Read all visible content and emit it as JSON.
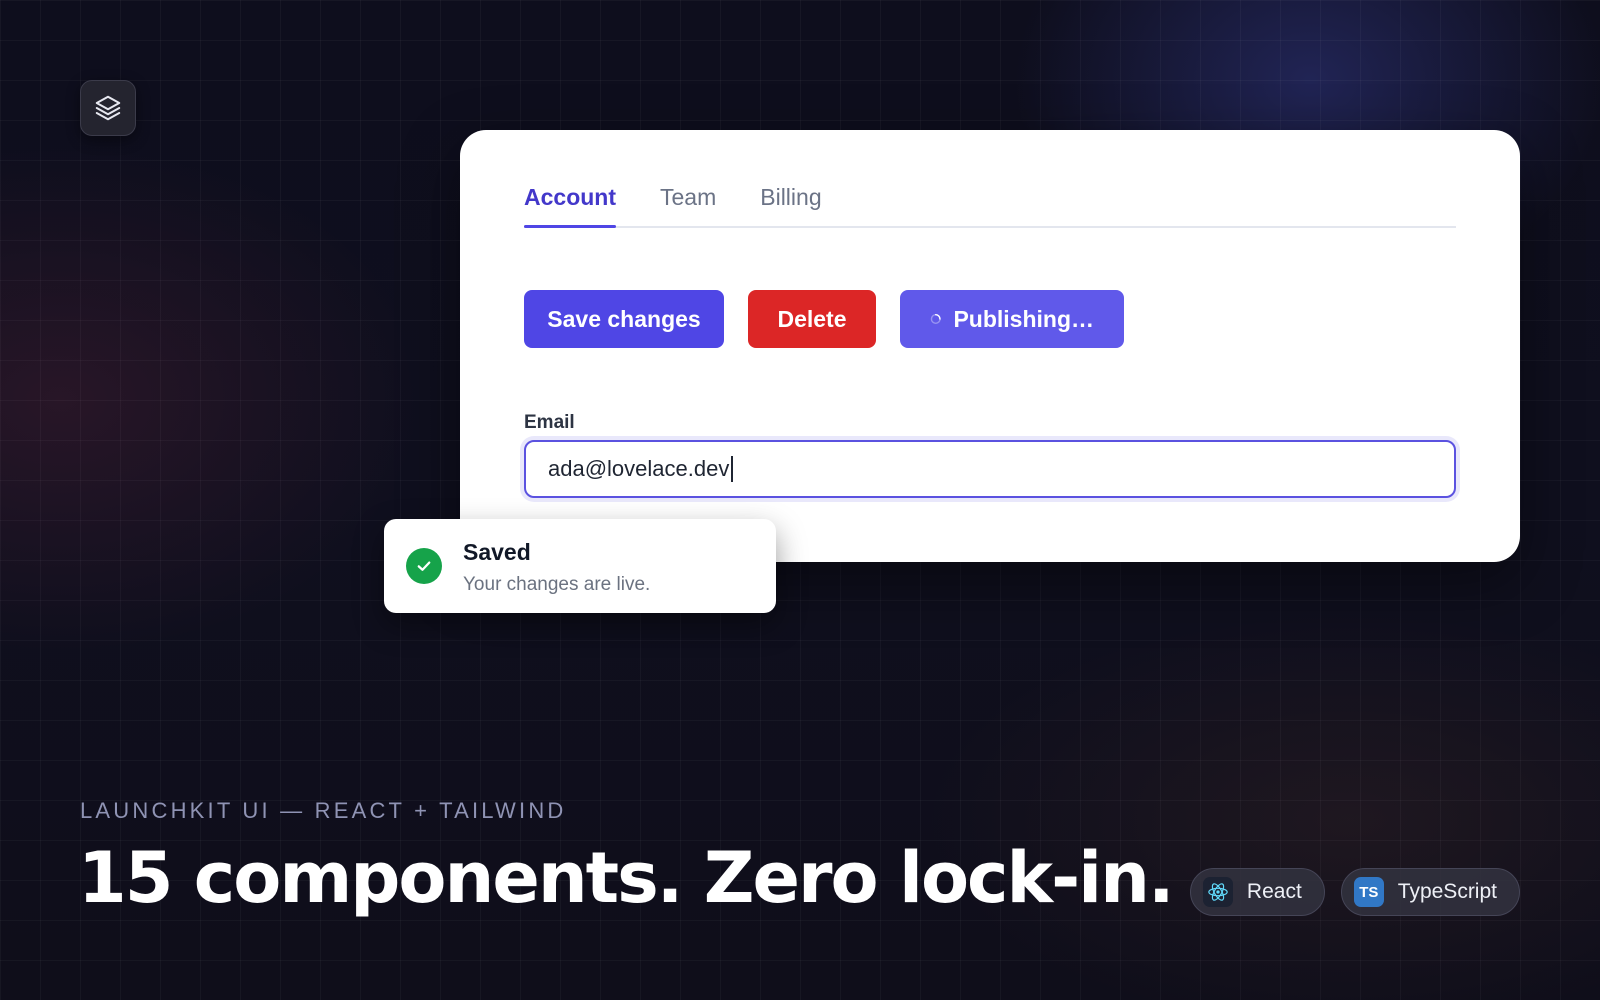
{
  "tabs": {
    "items": [
      {
        "label": "Account",
        "active": true
      },
      {
        "label": "Team",
        "active": false
      },
      {
        "label": "Billing",
        "active": false
      }
    ]
  },
  "buttons": {
    "save_label": "Save changes",
    "delete_label": "Delete",
    "publish_label": "Publishing…"
  },
  "email": {
    "label": "Email",
    "value": "ada@lovelace.dev"
  },
  "toast": {
    "title": "Saved",
    "message": "Your changes are live."
  },
  "hero": {
    "eyebrow": "LAUNCHKIT UI — REACT + TAILWIND",
    "headline": "15 components. Zero lock-in."
  },
  "badges": [
    {
      "label": "React",
      "icon": "react-icon"
    },
    {
      "label": "TypeScript",
      "icon": "typescript-icon",
      "icon_text": "TS"
    }
  ],
  "colors": {
    "primary": "#4f46e5",
    "danger": "#dc2626",
    "success": "#16a34a",
    "typescript": "#3178c6"
  }
}
